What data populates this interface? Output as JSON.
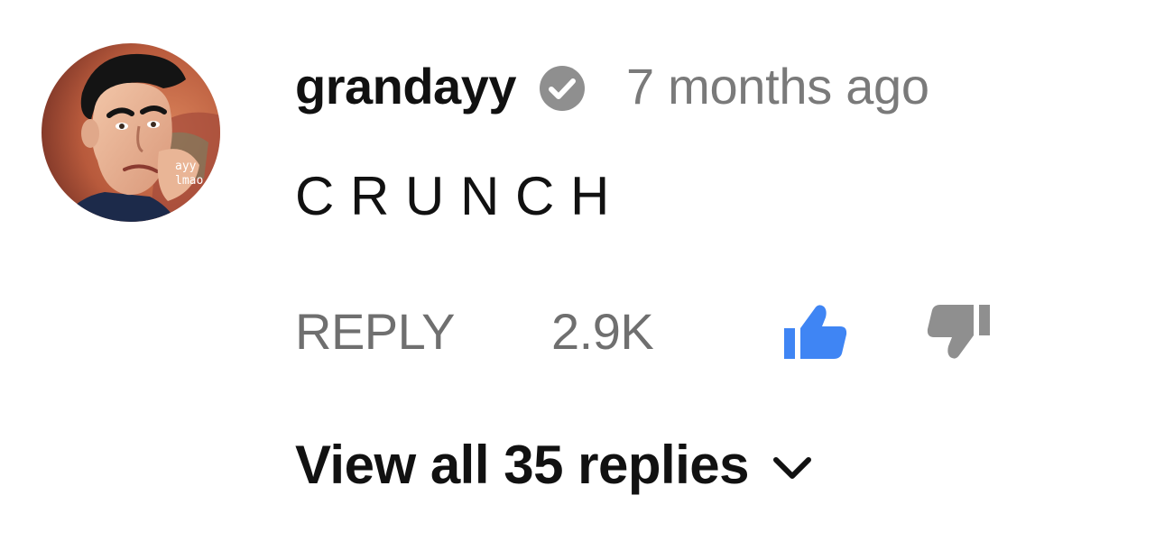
{
  "comment": {
    "author": "grandayy",
    "verified": true,
    "timestamp": "7 months ago",
    "text": "C R U N C H",
    "avatar": {
      "description_icon": "avatar-image",
      "overlay_text_1": "ayy",
      "overlay_text_2": "lmao"
    },
    "actions": {
      "reply_label": "REPLY",
      "like_count": "2.9K",
      "liked": true,
      "like_icon": "thumbs-up-icon",
      "dislike_icon": "thumbs-down-icon"
    },
    "replies": {
      "label": "View all 35 replies",
      "icon": "chevron-down-icon"
    }
  },
  "colors": {
    "text_primary": "#111111",
    "text_secondary": "#7a7a7a",
    "like_active": "#3f85f4",
    "icon_inactive": "#8f8f8f",
    "verified_badge": "#8f8f8f"
  }
}
